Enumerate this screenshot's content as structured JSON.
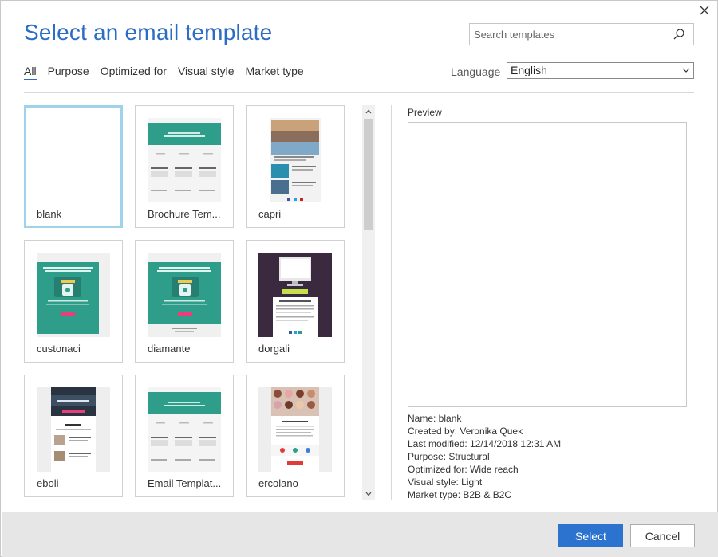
{
  "header": {
    "title": "Select an email template",
    "search_placeholder": "Search templates"
  },
  "tabs": [
    {
      "label": "All",
      "active": true
    },
    {
      "label": "Purpose"
    },
    {
      "label": "Optimized for"
    },
    {
      "label": "Visual style"
    },
    {
      "label": "Market type"
    }
  ],
  "language": {
    "label": "Language",
    "selected": "English"
  },
  "templates": [
    {
      "name": "blank",
      "selected": true
    },
    {
      "name": "Brochure Tem..."
    },
    {
      "name": "capri"
    },
    {
      "name": "custonaci"
    },
    {
      "name": "diamante"
    },
    {
      "name": "dorgali"
    },
    {
      "name": "eboli"
    },
    {
      "name": "Email Templat..."
    },
    {
      "name": "ercolano"
    }
  ],
  "preview": {
    "label": "Preview",
    "name": "Name: blank",
    "created_by": "Created by: Veronika Quek",
    "last_modified": "Last modified: 12/14/2018 12:31 AM",
    "purpose": "Purpose: Structural",
    "optimized_for": "Optimized for: Wide reach",
    "visual_style": "Visual style: Light",
    "market_type": "Market type: B2B & B2C"
  },
  "footer": {
    "select_label": "Select",
    "cancel_label": "Cancel"
  },
  "colors": {
    "accent": "#2b6cc4",
    "selected_border": "#9fd3ea",
    "teal": "#2e9d8a",
    "dark_purple": "#3b2a3f"
  }
}
